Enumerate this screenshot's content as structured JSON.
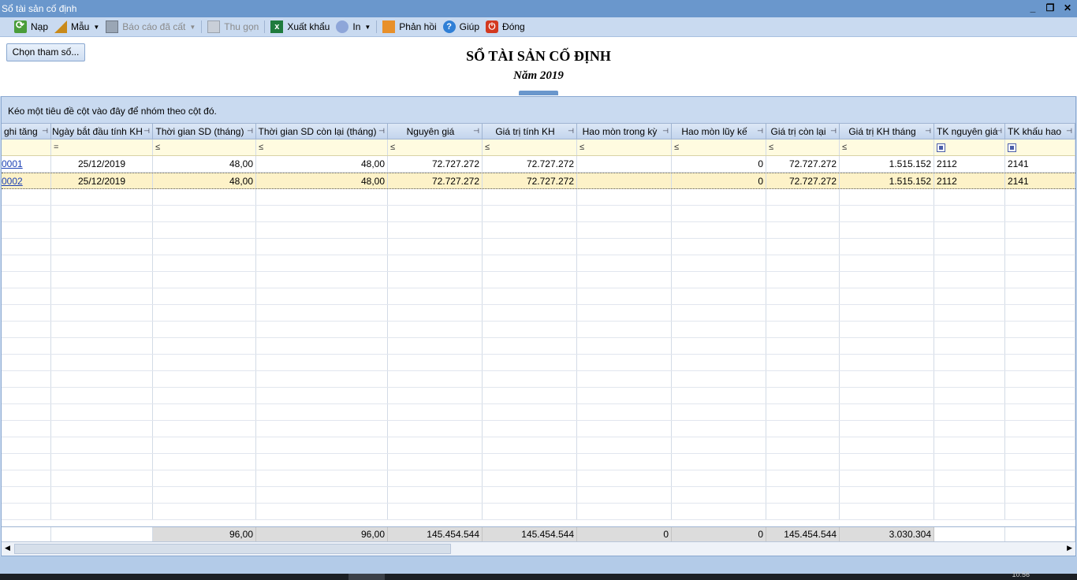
{
  "window": {
    "title": "Sổ tài sản cố định"
  },
  "toolbar": {
    "reload": "Nạp",
    "template": "Mẫu",
    "saved_reports": "Báo cáo đã cất",
    "collapse": "Thu gọn",
    "export": "Xuất khẩu",
    "print": "In",
    "feedback": "Phản hồi",
    "help": "Giúp",
    "close": "Đóng"
  },
  "header": {
    "param_button": "Chọn tham số...",
    "report_title": "SỔ TÀI SẢN CỐ ĐỊNH",
    "report_subtitle": "Năm 2019"
  },
  "grid": {
    "group_hint": "Kéo một tiêu đề cột vào đây để nhóm theo cột đó.",
    "columns": [
      "ghi tăng",
      "Ngày bắt đầu tính KH",
      "Thời gian SD (tháng)",
      "Thời gian SD còn lại (tháng)",
      "Nguyên giá",
      "Giá trị tính KH",
      "Hao mòn trong kỳ",
      "Hao mòn lũy kế",
      "Giá trị còn lại",
      "Giá trị KH tháng",
      "TK nguyên giá",
      "TK khấu hao"
    ],
    "filter_ops": [
      "",
      "=",
      "≤",
      "≤",
      "≤",
      "≤",
      "≤",
      "≤",
      "≤",
      "≤",
      "",
      ""
    ],
    "rows": [
      [
        "0001",
        "25/12/2019",
        "48,00",
        "48,00",
        "72.727.272",
        "72.727.272",
        "",
        "0",
        "72.727.272",
        "1.515.152",
        "2112",
        "2141"
      ],
      [
        "0002",
        "25/12/2019",
        "48,00",
        "48,00",
        "72.727.272",
        "72.727.272",
        "",
        "0",
        "72.727.272",
        "1.515.152",
        "2112",
        "2141"
      ]
    ],
    "selected_row": 1,
    "totals": [
      "",
      "",
      "96,00",
      "96,00",
      "145.454.544",
      "145.454.544",
      "0",
      "0",
      "145.454.544",
      "3.030.304",
      "",
      ""
    ]
  },
  "taskbar": {
    "clock": "10:56"
  }
}
